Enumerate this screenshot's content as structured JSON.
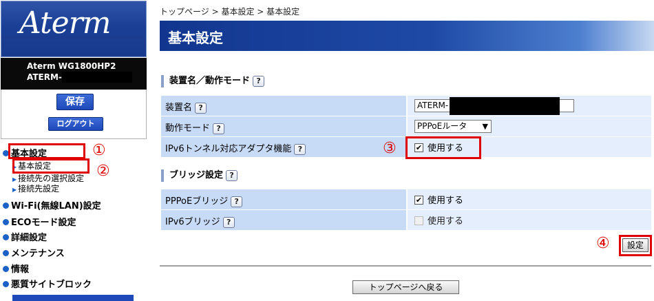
{
  "sidebar": {
    "logo": "Aterm",
    "model": "Aterm WG1800HP2",
    "device_id_prefix": "ATERM-",
    "save_label": "保存",
    "logout_label": "ログアウト",
    "nav": [
      {
        "label": "基本設定",
        "bullet": "blue-dot"
      },
      {
        "label": "基本設定",
        "sub": true
      },
      {
        "label": "接続先の選択設定",
        "sub": true
      },
      {
        "label": "接続先設定",
        "sub": true
      },
      {
        "label": "Wi-Fi(無線LAN)設定",
        "bullet": "blue-dot"
      },
      {
        "label": "ECOモード設定",
        "bullet": "blue-dot"
      },
      {
        "label": "詳細設定",
        "bullet": "blue-dot"
      },
      {
        "label": "メンテナンス",
        "bullet": "blue-dot"
      },
      {
        "label": "情報",
        "bullet": "blue-dot"
      },
      {
        "label": "悪質サイトブロック",
        "bullet": "blue-dot"
      }
    ]
  },
  "annotations": {
    "n1": "①",
    "n2": "②",
    "n3": "③",
    "n4": "④",
    "color": "#e00000"
  },
  "breadcrumb": "トップページ > 基本設定 > 基本設定",
  "page_title": "基本設定",
  "help_glyph": "?",
  "section1": {
    "heading": "装置名／動作モード",
    "rows": {
      "device_name": {
        "label": "装置名",
        "value": "ATERM-"
      },
      "mode": {
        "label": "動作モード",
        "value": "PPPoEルータ"
      },
      "ipv6_tunnel": {
        "label": "IPv6トンネル対応アダプタ機能",
        "check_label": "使用する",
        "checked": true
      }
    }
  },
  "section2": {
    "heading": "ブリッジ設定",
    "rows": {
      "pppoe_bridge": {
        "label": "PPPoEブリッジ",
        "check_label": "使用する",
        "checked": true
      },
      "ipv6_bridge": {
        "label": "IPv6ブリッジ",
        "check_label": "使用する",
        "checked": false,
        "disabled": true
      }
    }
  },
  "settings_button": "設定",
  "back_button": "トップページへ戻る",
  "colors": {
    "label_bg": "#c7daf6",
    "value_bg": "#e5eefc",
    "title_bar": "#1e4aa6",
    "nav_bullet": "#1c61c8"
  }
}
